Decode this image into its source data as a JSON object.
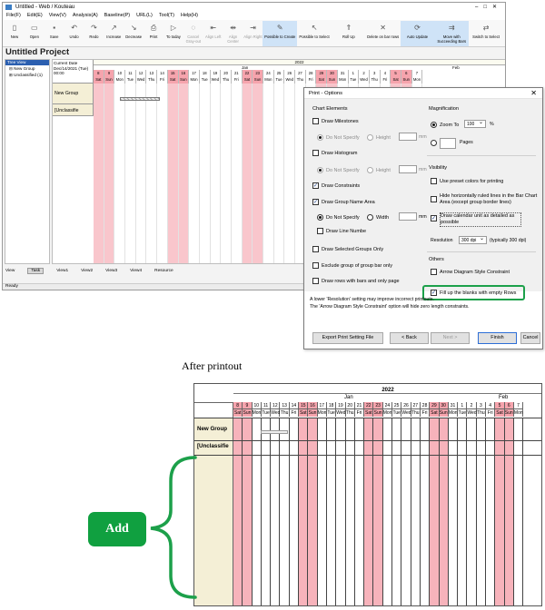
{
  "app": {
    "window_title": "Untitled - Web / Kouteau",
    "menus": [
      "File(F)",
      "Edit(E)",
      "View(V)",
      "Analysis(A)",
      "Baseline(P)",
      "URL(L)",
      "Tool(T)",
      "Help(H)"
    ],
    "toolbar": [
      {
        "label": "New",
        "icon": "new-file-icon"
      },
      {
        "label": "Open",
        "icon": "folder-open-icon"
      },
      {
        "label": "Save",
        "icon": "save-icon"
      },
      {
        "label": "Undo",
        "icon": "undo-icon"
      },
      {
        "label": "Redo",
        "icon": "redo-icon"
      },
      {
        "label": "Increase",
        "icon": "increase-icon"
      },
      {
        "label": "Decrease",
        "icon": "decrease-icon"
      },
      {
        "label": "Print",
        "icon": "print-icon"
      },
      {
        "label": "To today",
        "icon": "today-icon"
      },
      {
        "label": "Cancel Gray-out",
        "icon": "grayout-icon"
      },
      {
        "label": "Align Left",
        "icon": "align-left-icon"
      },
      {
        "label": "Align Center",
        "icon": "align-center-icon"
      },
      {
        "label": "Align Right",
        "icon": "align-right-icon"
      },
      {
        "label": "Possible to Create",
        "icon": "create-icon"
      },
      {
        "label": "Possible to Select",
        "icon": "select-icon"
      },
      {
        "label": "Roll Up",
        "icon": "rollup-icon"
      },
      {
        "label": "Delete on bar rows",
        "icon": "delete-icon"
      },
      {
        "label": "Auto Update",
        "icon": "auto-update-icon"
      },
      {
        "label": "Move with Succeeding Bars",
        "icon": "move-bars-icon"
      },
      {
        "label": "Switch to Select",
        "icon": "switch-select-icon"
      }
    ],
    "project_title": "Untitled Project",
    "tree": {
      "header": "Tree View",
      "items": [
        "New Group",
        "Unclassified (1)"
      ]
    },
    "gantt": {
      "current_date_label": "Current Date",
      "current_date_value": "Dec/14/2021 (Tue)",
      "current_time": "00:00",
      "year": "2022",
      "month_jan": "Jan",
      "month_feb": "Feb",
      "days": [
        "8",
        "9",
        "10",
        "11",
        "12",
        "13",
        "14",
        "15",
        "16",
        "17",
        "18",
        "19",
        "20",
        "21",
        "22",
        "23",
        "24",
        "25",
        "26",
        "27",
        "28",
        "29",
        "30",
        "31",
        "1",
        "2",
        "3",
        "4",
        "5",
        "6",
        "7"
      ],
      "weekdays": [
        "Sat",
        "Sun",
        "Mon",
        "Tue",
        "Wed",
        "Thu",
        "Fri",
        "Sat",
        "Sun",
        "Mon",
        "Tue",
        "Wed",
        "Thu",
        "Fri",
        "Sat",
        "Sun",
        "Mon",
        "Tue",
        "Wed",
        "Thu",
        "Fri",
        "Sat",
        "Sun",
        "Mon",
        "Tue",
        "Wed",
        "Thu",
        "Fri",
        "Sat",
        "Sun",
        "Mon"
      ],
      "rows": [
        "New Group",
        "[Unclassifie"
      ]
    },
    "view_tabs": [
      "View",
      "Task",
      "View1",
      "View2",
      "View3",
      "View4",
      "Resource"
    ],
    "status": "Ready"
  },
  "dialog": {
    "title": "Print - Options",
    "chart_elements": "Chart Elements",
    "draw_milestones": "Draw Milestones",
    "do_not_specify": "Do Not Specify",
    "height": "Height",
    "mm": "mm",
    "draw_histogram": "Draw Histogram",
    "draw_constraints": "Draw Constraints",
    "draw_group_name_area": "Draw Group Name Area",
    "width": "Width",
    "draw_line_number": "Draw Line Numbe",
    "draw_selected_groups": "Draw Selected Groups Only",
    "exclude_group": "Exclude group of group bar only",
    "draw_rows_with_bars": "Draw rows with bars and only page",
    "magnification": "Magnification",
    "zoom_to": "Zoom To",
    "zoom_value": "100",
    "percent": "%",
    "pages": "Pages",
    "visibility": "Visibility",
    "use_preset_colors": "Use preset colors for printing",
    "hide_ruled_lines": "Hide horizontally ruled lines in the Bar Chart Area (except group border lines)",
    "draw_calendar_unit": "Draw calendar unit as detailed as possible",
    "resolution": "Resolution",
    "resolution_value": "300 dpi",
    "resolution_hint": "(typically 300 dpi)",
    "others": "Others",
    "arrow_diagram": "Arrow Diagram Style Constraint",
    "fill_blanks": "Fill up the blanks with empty Rows",
    "note1": "A lower 'Resolution' setting may improve incorrect printouts.",
    "note2": "The 'Arrow Diagram Style Constraint' option will hide zero length constraints.",
    "btn_export": "Export Print Setting File",
    "btn_back": "< Back",
    "btn_next": "Next >",
    "btn_finish": "Finish",
    "btn_cancel": "Cancel"
  },
  "caption": "After printout",
  "printout": {
    "year": "2022",
    "month_jan": "Jan",
    "month_feb": "Feb",
    "rows": [
      "New Group",
      "[Unclassifie"
    ]
  },
  "add_label": "Add",
  "colors": {
    "weekend": "#f6a4ad",
    "group_area": "#f4efd6",
    "highlight_green": "#1ca04a"
  }
}
